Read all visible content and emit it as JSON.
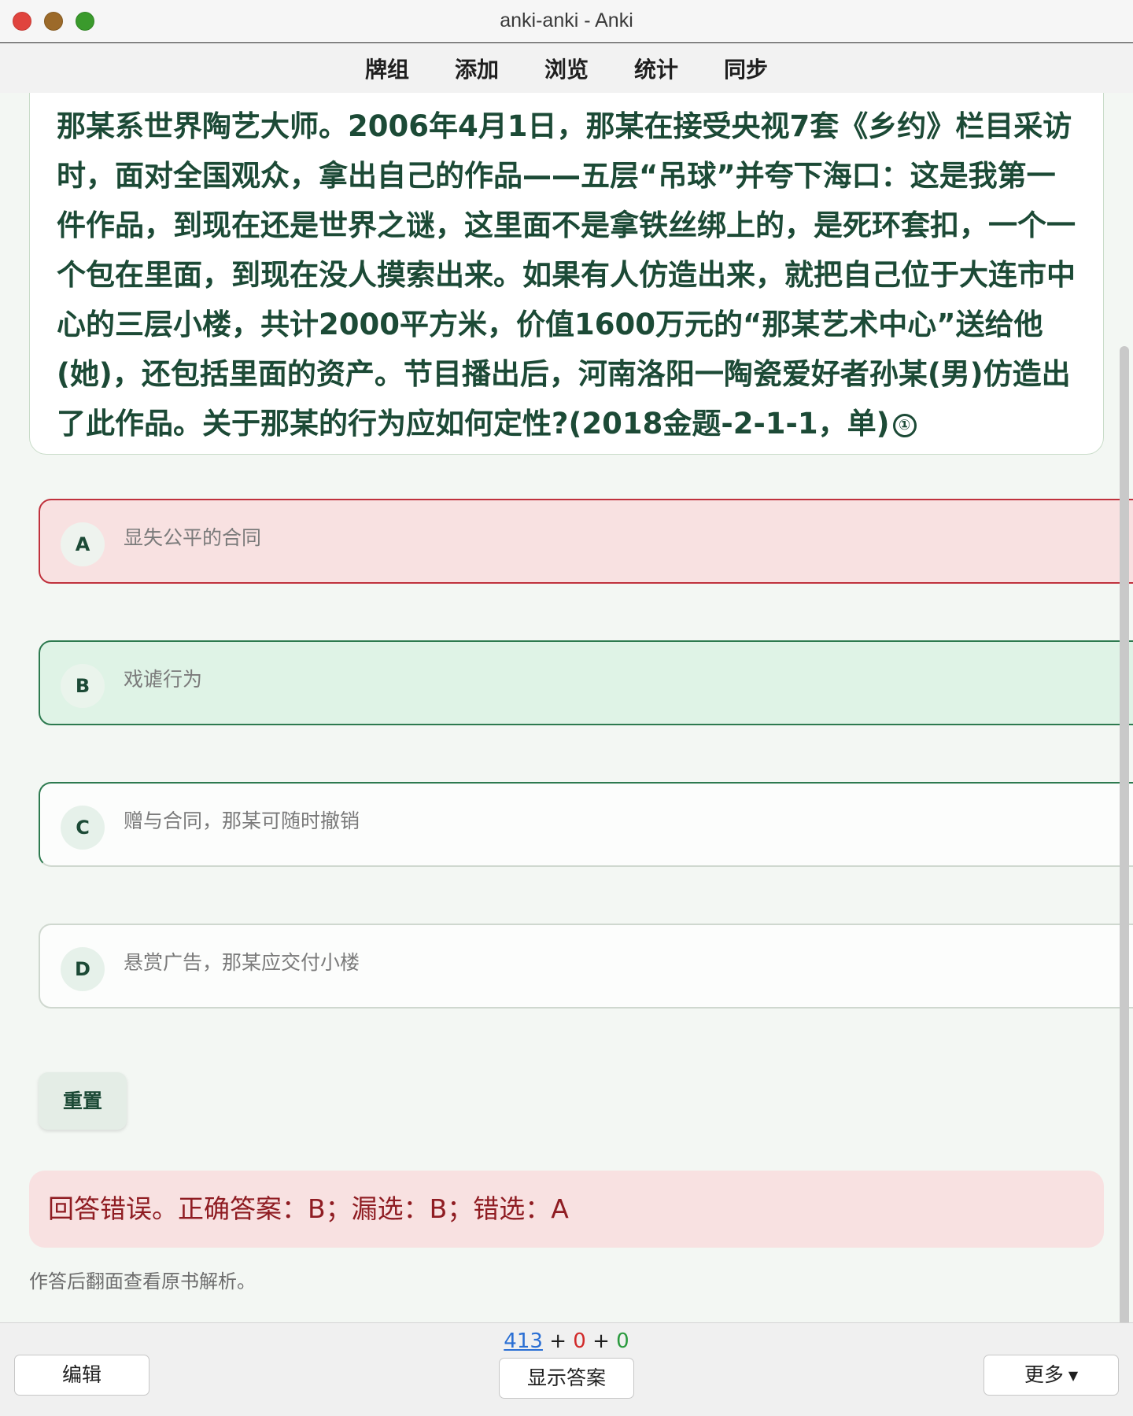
{
  "window": {
    "title": "anki-anki - Anki"
  },
  "menu": {
    "items": [
      "牌组",
      "添加",
      "浏览",
      "统计",
      "同步"
    ]
  },
  "question": {
    "text": "那某系世界陶艺大师。2006年4月1日，那某在接受央视7套《乡约》栏目采访时，面对全国观众，拿出自己的作品——五层“吊球”并夸下海口：这是我第一件作品，到现在还是世界之谜，这里面不是拿铁丝绑上的，是死环套扣，一个一个包在里面，到现在没人摸索出来。如果有人仿造出来，就把自己位于大连市中心的三层小楼，共计2000平方米，价值1600万元的“那某艺术中心”送给他(她)，还包括里面的资产。节目播出后，河南洛阳一陶瓷爱好者孙某(男)仿造出了此作品。关于那某的行为应如何定性?(2018金题-2-1-1，单)",
    "info_icon": "①"
  },
  "options": [
    {
      "letter": "A",
      "text": "显失公平的合同",
      "state": "wrong"
    },
    {
      "letter": "B",
      "text": "戏谑行为",
      "state": "correct"
    },
    {
      "letter": "C",
      "text": "赠与合同，那某可随时撤销",
      "state": "plain"
    },
    {
      "letter": "D",
      "text": "悬赏广告，那某应交付小楼",
      "state": "plain"
    }
  ],
  "reset_label": "重置",
  "result": "回答错误。正确答案：B；漏选：B；错选：A",
  "hint": "作答后翻面查看原书解析。",
  "bottom": {
    "edit_label": "编辑",
    "show_answer_label": "显示答案",
    "more_label": "更多",
    "counts": {
      "new": "413",
      "learn": "0",
      "review": "0",
      "sep": "+"
    }
  },
  "colors": {
    "accent": "#1c4a36",
    "wrong": "#c0323d",
    "correct": "#2d7a4f",
    "new_count": "#2a6fd4",
    "learn_count": "#d12a2a",
    "review_count": "#2a9a3e"
  }
}
